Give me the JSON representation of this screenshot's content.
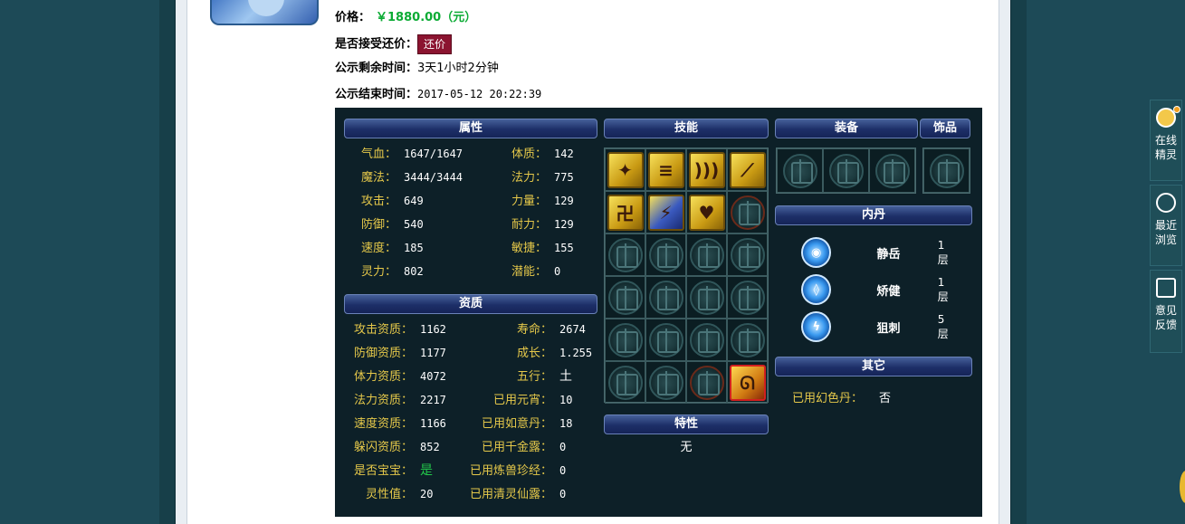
{
  "listing": {
    "price_label": "价格：",
    "price_value": "￥1880.00（元）",
    "bargain_label": "是否接受还价：",
    "bargain_button": "还价",
    "remain_label": "公示剩余时间：",
    "remain_value": "3天1小时2分钟",
    "end_label": "公示结束时间：",
    "end_value": "2017-05-12 20:22:39"
  },
  "headers": {
    "attributes": "属性",
    "skills": "技能",
    "equipment": "装备",
    "ornament": "饰品",
    "aptitude": "资质",
    "inner_core": "内丹",
    "other": "其它",
    "traits": "特性"
  },
  "attributes": [
    {
      "k": "气血：",
      "v": "1647/1647"
    },
    {
      "k": "体质：",
      "v": "142"
    },
    {
      "k": "魔法：",
      "v": "3444/3444"
    },
    {
      "k": "法力：",
      "v": "775"
    },
    {
      "k": "攻击：",
      "v": "649"
    },
    {
      "k": "力量：",
      "v": "129"
    },
    {
      "k": "防御：",
      "v": "540"
    },
    {
      "k": "耐力：",
      "v": "129"
    },
    {
      "k": "速度：",
      "v": "185"
    },
    {
      "k": "敏捷：",
      "v": "155"
    },
    {
      "k": "灵力：",
      "v": "802"
    },
    {
      "k": "潜能：",
      "v": "0"
    }
  ],
  "aptitude": [
    {
      "k": "攻击资质：",
      "v": "1162"
    },
    {
      "k": "寿命：",
      "v": "2674"
    },
    {
      "k": "防御资质：",
      "v": "1177"
    },
    {
      "k": "成长：",
      "v": "1.255"
    },
    {
      "k": "体力资质：",
      "v": "4072"
    },
    {
      "k": "五行：",
      "v": "土"
    },
    {
      "k": "法力资质：",
      "v": "2217"
    },
    {
      "k": "已用元宵：",
      "v": "10"
    },
    {
      "k": "速度资质：",
      "v": "1166"
    },
    {
      "k": "已用如意丹：",
      "v": "18"
    },
    {
      "k": "躲闪资质：",
      "v": "852"
    },
    {
      "k": "已用千金露：",
      "v": "0"
    },
    {
      "k": "是否宝宝：",
      "v": "是"
    },
    {
      "k": "已用炼兽珍经：",
      "v": "0"
    },
    {
      "k": "灵性值：",
      "v": "20"
    },
    {
      "k": "已用清灵仙露：",
      "v": "0"
    }
  ],
  "inner_core": [
    {
      "name": "静岳",
      "level": "1层"
    },
    {
      "name": "矫健",
      "level": "1层"
    },
    {
      "name": "狙刺",
      "level": "5层"
    }
  ],
  "other": {
    "label": "已用幻色丹：",
    "value": "否"
  },
  "traits_value": "无",
  "sidebar": {
    "online": "在线精灵",
    "recent": "最近浏览",
    "feedback": "意见反馈"
  },
  "colors": {
    "price_green": "#0bab34",
    "label_gold": "#e5c84a",
    "bargain_red": "#8b1430",
    "panel_dark": "#0d2028"
  }
}
